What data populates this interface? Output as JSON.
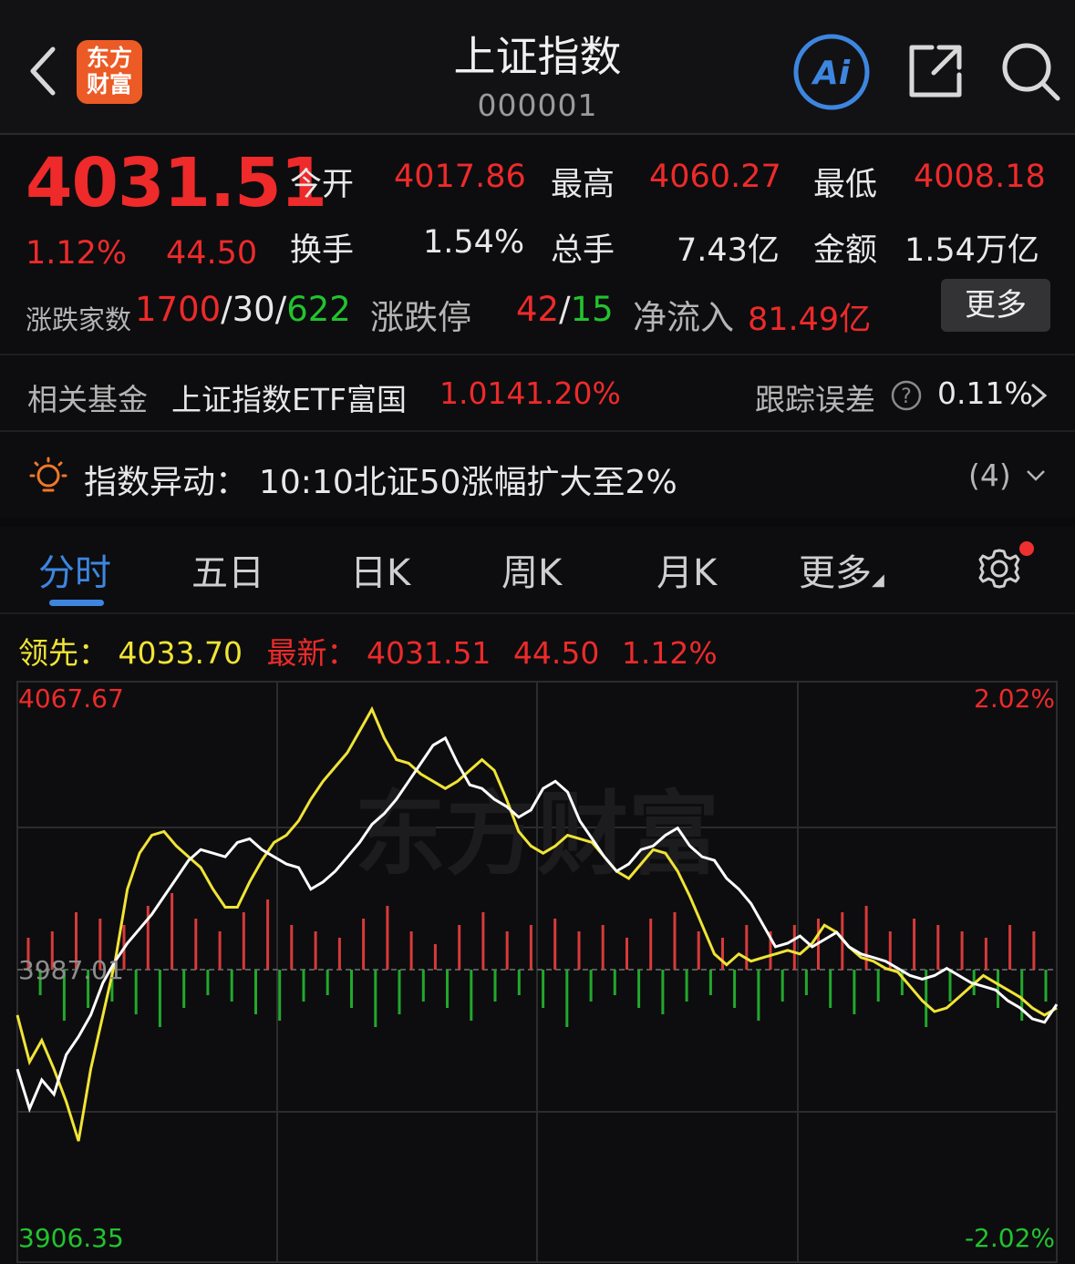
{
  "header": {
    "title": "上证指数",
    "code": "000001",
    "logo_line1": "东方",
    "logo_line2": "财富",
    "ai_label": "Ai"
  },
  "quote": {
    "price": "4031.51",
    "change_pct": "1.12%",
    "change": "44.50",
    "open_label": "今开",
    "open": "4017.86",
    "high_label": "最高",
    "high": "4060.27",
    "low_label": "最低",
    "low": "4008.18",
    "turnover_label": "换手",
    "turnover": "1.54%",
    "volume_label": "总手",
    "volume": "7.43亿",
    "amount_label": "金额",
    "amount": "1.54万亿",
    "breadth_label": "涨跌家数",
    "up_count": "1700",
    "flat_count": "30",
    "down_count": "622",
    "limit_label": "涨跌停",
    "limit_up": "42",
    "limit_down": "15",
    "netflow_label": "净流入",
    "netflow": "81.49亿",
    "more_label": "更多"
  },
  "fund": {
    "label": "相关基金",
    "name": "上证指数ETF富国",
    "price": "1.014",
    "pct": "1.20%",
    "tracking_label": "跟踪误差",
    "tracking": "0.11%"
  },
  "alert": {
    "label": "指数异动：",
    "text": "10:10北证50涨幅扩大至2%",
    "count": "(4)"
  },
  "tabs": [
    "分时",
    "五日",
    "日K",
    "周K",
    "月K",
    "更多"
  ],
  "legend": {
    "lead_label": "领先：",
    "lead_value": "4033.70",
    "latest_label": "最新：",
    "latest_value": "4031.51",
    "latest_change": "44.50",
    "latest_pct": "1.12%"
  },
  "chart_data": {
    "type": "line",
    "y_max_label": "4067.67",
    "y_min_label": "3906.35",
    "pct_max_label": "2.02%",
    "pct_min_label": "-2.02%",
    "prev_close_label": "3987.01",
    "ylim": [
      3906.35,
      4067.67
    ],
    "watermark": "东方财富",
    "series": [
      {
        "color": "#ffffff",
        "values": [
          3960,
          3949,
          3957,
          3953,
          3964,
          3969,
          3975,
          3984,
          3990,
          3995,
          3999,
          4003,
          4008,
          4013,
          4018,
          4021,
          4020,
          4019,
          4023,
          4024,
          4021,
          4019,
          4017,
          4016,
          4010,
          4012,
          4015,
          4019,
          4023,
          4028,
          4031,
          4035,
          4040,
          4045,
          4050,
          4052,
          4045,
          4039,
          4038,
          4035,
          4033,
          4030,
          4032,
          4038,
          4040,
          4037,
          4029,
          4024,
          4019,
          4015,
          4017,
          4021,
          4022,
          4025,
          4027,
          4022,
          4019,
          4018,
          4013,
          4010,
          4006,
          4000,
          3994,
          3995,
          3997,
          3994,
          3996,
          3998,
          3994,
          3992,
          3991,
          3990,
          3988,
          3986,
          3985,
          3986,
          3988,
          3986,
          3984,
          3983,
          3982,
          3979,
          3977,
          3974,
          3973,
          3978
        ]
      },
      {
        "color": "#f0e436",
        "values": [
          3975,
          3962,
          3968,
          3960,
          3951,
          3940,
          3960,
          3975,
          3990,
          4010,
          4020,
          4025,
          4026,
          4022,
          4019,
          4016,
          4010,
          4005,
          4005,
          4012,
          4018,
          4023,
          4025,
          4029,
          4035,
          4040,
          4044,
          4048,
          4054,
          4060,
          4052,
          4046,
          4045,
          4042,
          4040,
          4038,
          4040,
          4043,
          4046,
          4043,
          4035,
          4026,
          4022,
          4020,
          4022,
          4025,
          4024,
          4023,
          4019,
          4015,
          4013,
          4017,
          4021,
          4020,
          4015,
          4008,
          4000,
          3992,
          3989,
          3992,
          3990,
          3991,
          3992,
          3993,
          3992,
          3995,
          4000,
          3998,
          3994,
          3991,
          3990,
          3988,
          3987,
          3983,
          3979,
          3976,
          3977,
          3980,
          3983,
          3986,
          3984,
          3982,
          3980,
          3977,
          3975,
          3977
        ]
      }
    ],
    "volume_bars": [
      5,
      -4,
      6,
      -8,
      9,
      -6,
      8,
      -5,
      7,
      -7,
      10,
      -9,
      12,
      -6,
      8,
      -4,
      6,
      -5,
      9,
      -7,
      11,
      -8,
      7,
      -5,
      6,
      -4,
      5,
      -6,
      8,
      -9,
      10,
      -7,
      6,
      -5,
      4,
      -6,
      7,
      -8,
      9,
      -5,
      6,
      -4,
      7,
      -6,
      8,
      -9,
      6,
      -5,
      7,
      -4,
      5,
      -6,
      8,
      -7,
      9,
      -5,
      6,
      -4,
      5,
      -6,
      7,
      -8,
      6,
      -5,
      7,
      -4,
      8,
      -6,
      9,
      -7,
      10,
      -5,
      6,
      -4,
      8,
      -9,
      7,
      -5,
      6,
      -4,
      5,
      -6,
      7,
      -8,
      6,
      -5
    ]
  }
}
